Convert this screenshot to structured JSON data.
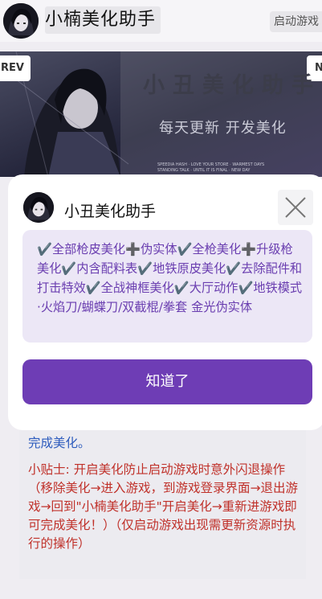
{
  "header": {
    "title": "小楠美化助手",
    "action_label": "启动游戏"
  },
  "banner": {
    "prev_label": "REV",
    "next_label": "N",
    "title": "小丑美化助手",
    "subtitle": "每天更新 开发美化"
  },
  "background_content": {
    "line_blue": "完成美化。",
    "tip": "小贴士: 开启美化防止启动游戏时意外闪退操作（移除美化→进入游戏，到游戏登录界面→退出游戏→回到\"小楠美化助手\"开启美化→重新进游戏即可完成美化！）（仅启动游戏出现需更新资源时执行的操作）"
  },
  "modal": {
    "title": "小丑美化助手",
    "features": "✔️全部枪皮美化➕伪实体✔️全枪美化➕升级枪美化✔️内含配料表✔️地铁原皮美化✔️去除配件和打击特效✔️全战神框美化✔️大厅动作✔️地铁模式·火焰刀/蝴蝶刀/双截棍/拳套 金光伪实体",
    "confirm_label": "知道了"
  },
  "colors": {
    "accent": "#6e3db5",
    "feature_text": "#6a3eb0",
    "feature_bg": "#ece7f6",
    "tip_red": "#c0312a",
    "link_blue": "#2d5bbd"
  },
  "icons": {
    "avatar": "anime-character-avatar",
    "close": "close-icon"
  }
}
